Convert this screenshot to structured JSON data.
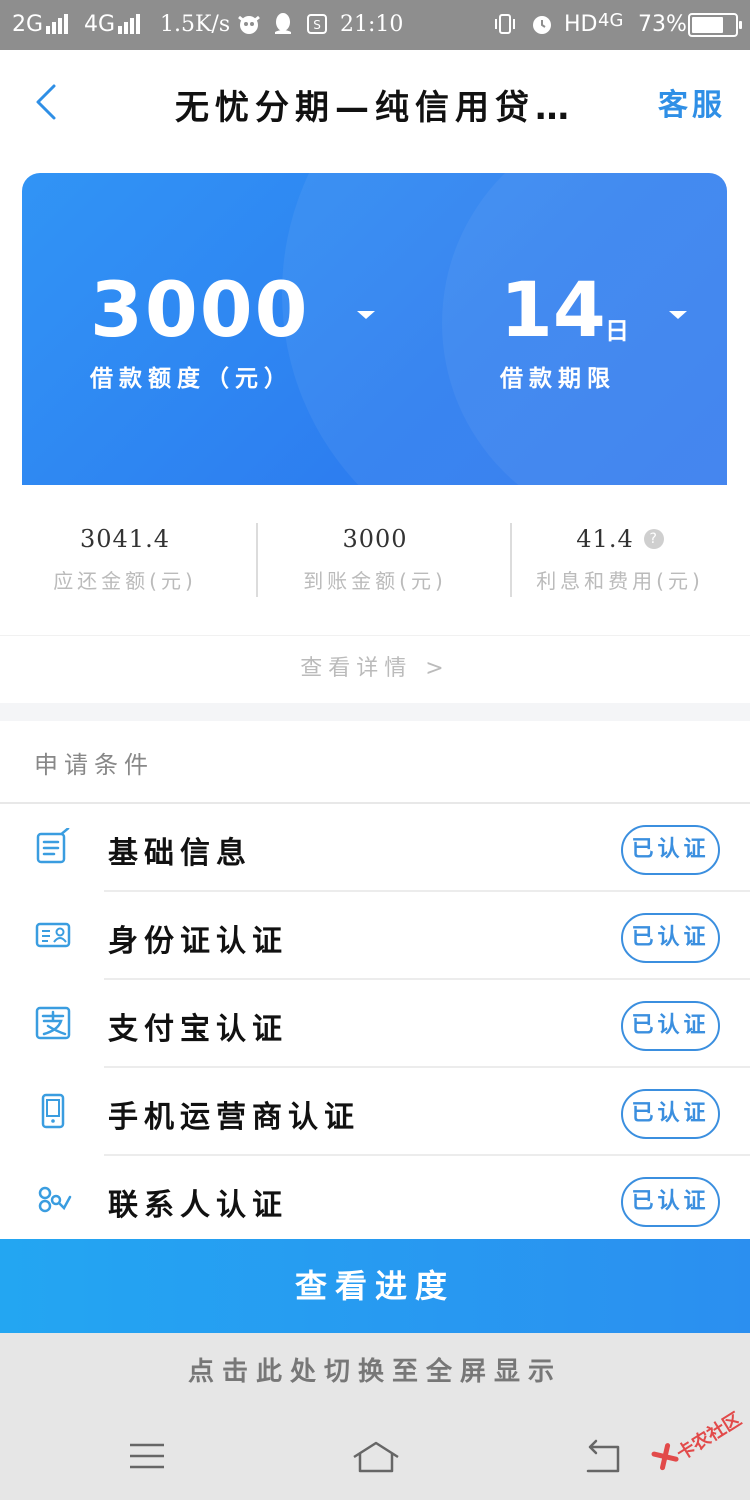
{
  "status_bar": {
    "sim1": "2G",
    "sim2": "4G",
    "net_speed": "1.5K/s",
    "time": "21:10",
    "hd": "HD",
    "net_type": "4G",
    "battery_percent": "73%",
    "battery_level": 0.73
  },
  "header": {
    "title": "无忧分期—纯信用贷…",
    "customer_service": "客服"
  },
  "loan": {
    "amount": "3000",
    "amount_label": "借款额度（元）",
    "term": "14",
    "term_unit": "日",
    "term_label": "借款期限"
  },
  "summary": {
    "repay_value": "3041.4",
    "repay_label": "应还金额(元)",
    "receive_value": "3000",
    "receive_label": "到账金额(元)",
    "fee_value": "41.4",
    "fee_label": "利息和费用(元)",
    "fee_help": "?",
    "details_link": "查看详情 >"
  },
  "conditions": {
    "title": "申请条件",
    "items": [
      {
        "label": "基础信息",
        "status": "已认证",
        "icon": "document-icon"
      },
      {
        "label": "身份证认证",
        "status": "已认证",
        "icon": "id-card-icon"
      },
      {
        "label": "支付宝认证",
        "status": "已认证",
        "icon": "alipay-icon"
      },
      {
        "label": "手机运营商认证",
        "status": "已认证",
        "icon": "phone-icon"
      },
      {
        "label": "联系人认证",
        "status": "已认证",
        "icon": "contacts-icon"
      }
    ]
  },
  "actions": {
    "progress_button": "查看进度",
    "fullscreen_hint": "点击此处切换至全屏显示"
  },
  "watermark": "卡农社区",
  "colors": {
    "accent": "#2f8fe6",
    "card_blue": "#2d7ef0",
    "button_blue": "#23a6f2",
    "status_bar": "#8e8e8e"
  }
}
